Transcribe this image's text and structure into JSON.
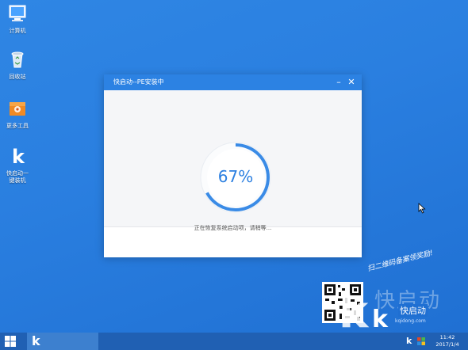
{
  "desktop": {
    "icons": [
      {
        "label": "计算机",
        "icon": "computer-icon"
      },
      {
        "label": "回收站",
        "icon": "recycle-bin-icon"
      },
      {
        "label": "更多工具",
        "icon": "toolbox-icon"
      },
      {
        "label_line1": "快启动一",
        "label_line2": "键装机",
        "icon": "kqidong-k-icon"
      }
    ]
  },
  "dialog": {
    "title": "快启动--PE安装中",
    "progress_text": "67%",
    "progress": 0.67,
    "status": "正在恢复系统启动项，请稍等..."
  },
  "watermark": {
    "slogan": "扫二维码备案领奖励!",
    "brand": "快启动",
    "brand_small": "快启动",
    "url": "kqidong.com"
  },
  "taskbar": {
    "time": "11:42",
    "date": "2017/1/4",
    "tray_k": "k"
  },
  "colors": {
    "accent": "#2c82e3",
    "ring": "#3a8be6"
  }
}
